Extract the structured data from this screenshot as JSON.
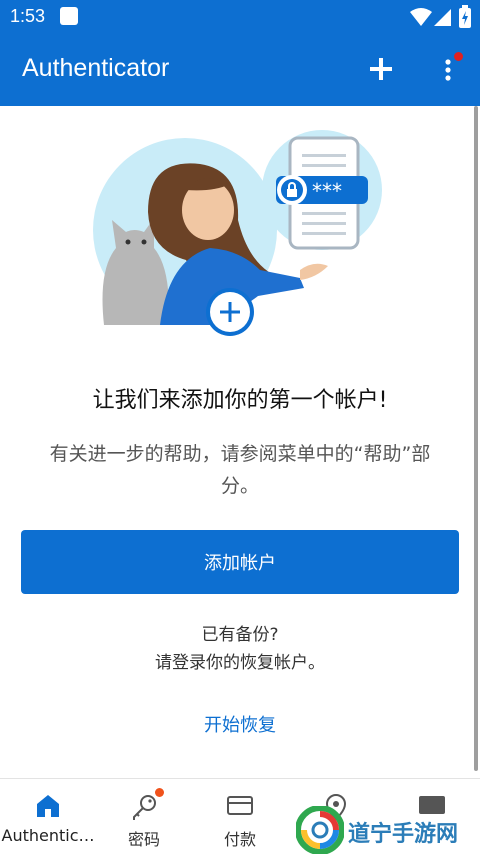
{
  "status_bar": {
    "time": "1:53"
  },
  "app_bar": {
    "title": "Authenticator"
  },
  "illustration": {
    "masked_password": "***"
  },
  "empty_state": {
    "headline": "让我们来添加你的第一个帐户!",
    "description": "有关进一步的帮助，请参阅菜单中的“帮助”部分。"
  },
  "add_account_button": "添加帐户",
  "backup": {
    "line1": "已有备份?",
    "line2": "请登录你的恢复帐户。",
    "restore_link": "开始恢复"
  },
  "bottom_nav": {
    "items": [
      {
        "label": "Authentic…",
        "icon": "home-icon",
        "active": true
      },
      {
        "label": "密码",
        "icon": "key-icon",
        "badge": true
      },
      {
        "label": "付款",
        "icon": "wallet-icon"
      },
      {
        "label": "",
        "icon": "location-icon"
      },
      {
        "label": "",
        "icon": "id-card-icon"
      }
    ]
  },
  "watermark": {
    "text": "道宁手游网"
  },
  "colors": {
    "primary": "#0d6fd1",
    "badge": "#f0521b",
    "menu_dot": "#e02020"
  }
}
